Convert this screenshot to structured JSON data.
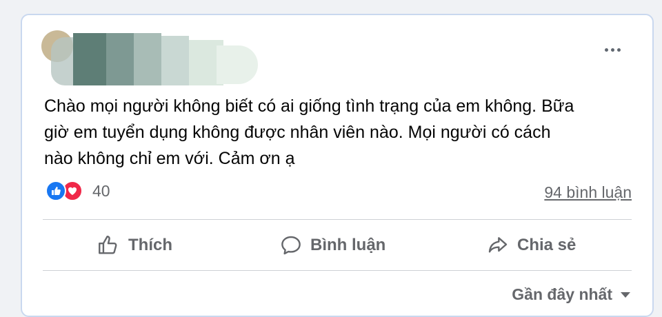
{
  "post": {
    "text": "Chào mọi người không biết có ai giống tình trạng của em không. Bữa\ngiờ em tuyển dụng không được nhân viên nào. Mọi người có cách\nnào không chỉ em với. Cảm ơn ạ",
    "reaction_count": "40",
    "reactions": [
      "like-icon",
      "love-icon"
    ],
    "comment_count_label": "94 bình luận"
  },
  "actions": {
    "like_label": "Thích",
    "comment_label": "Bình luận",
    "share_label": "Chia sẻ"
  },
  "comments_sort": {
    "label": "Gần đây nhất"
  },
  "colors": {
    "like_blue": "#1877f2",
    "love_red": "#f02849",
    "secondary_text": "#65676b",
    "card_border": "#c9d8ef"
  }
}
